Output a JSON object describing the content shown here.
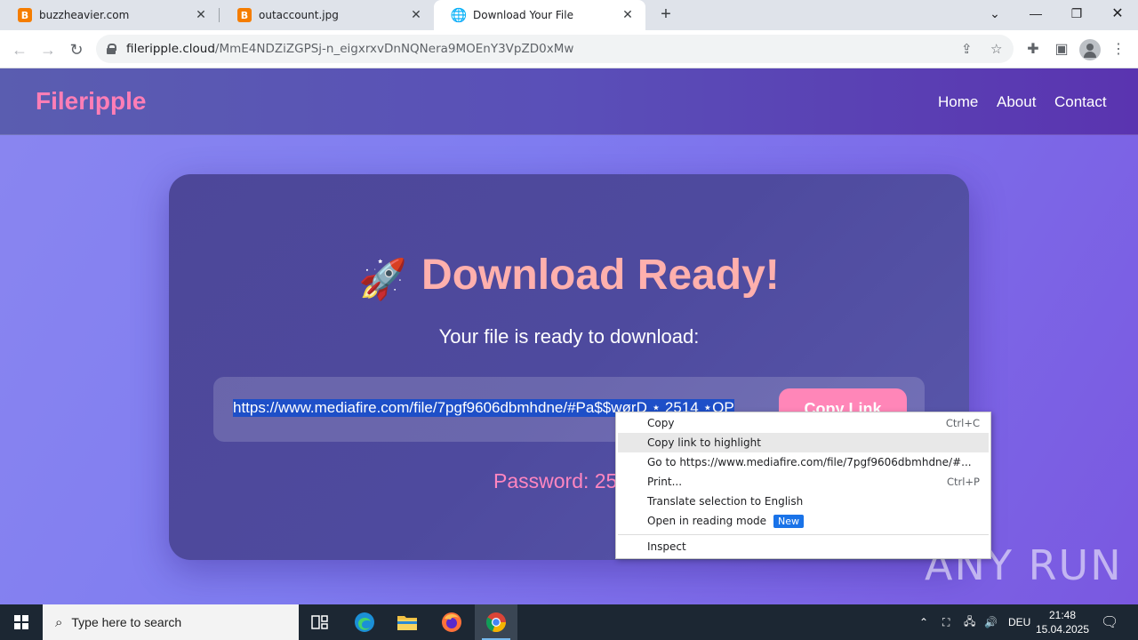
{
  "browser": {
    "tabs": [
      {
        "title": "buzzheavier.com",
        "favicon": "B",
        "active": false
      },
      {
        "title": "outaccount.jpg",
        "favicon": "B",
        "active": false
      },
      {
        "title": "Download Your File",
        "favicon": "globe-icon",
        "active": true
      }
    ],
    "url_host": "fileripple.cloud",
    "url_path": "/MmE4NDZiZGPSj-n_eigxrxvDnNQNera9MOEnY3VpZD0xMw"
  },
  "site": {
    "logo": "Fileripple",
    "nav": [
      "Home",
      "About",
      "Contact"
    ]
  },
  "card": {
    "heading": "Download Ready!",
    "subtitle": "Your file is ready to download:",
    "link_text": "https://www.mediafire.com/file/7pgf9606dbmhdne/#Pa$$wørD ⋆ 2514  ⋆OP",
    "copy_button": "Copy Link",
    "password_label": "Password: 25"
  },
  "context_menu": {
    "items": [
      {
        "label": "Copy",
        "shortcut": "Ctrl+C"
      },
      {
        "label": "Copy link to highlight",
        "shortcut": ""
      },
      {
        "label": "Go to https://www.mediafire.com/file/7pgf9606dbmhdne/#...",
        "shortcut": ""
      },
      {
        "label": "Print...",
        "shortcut": "Ctrl+P"
      },
      {
        "label": "Translate selection to English",
        "shortcut": ""
      },
      {
        "label": "Open in reading mode",
        "shortcut": "",
        "badge": "New"
      },
      {
        "label": "Inspect",
        "shortcut": ""
      }
    ]
  },
  "watermark": "ANY RUN",
  "taskbar": {
    "search_placeholder": "Type here to search",
    "language": "DEU",
    "time": "21:48",
    "date": "15.04.2025"
  },
  "colors": {
    "accent_pink": "#ff86b8",
    "heading_peach": "#ffb0ad",
    "selection_blue": "#1e4fc8"
  }
}
